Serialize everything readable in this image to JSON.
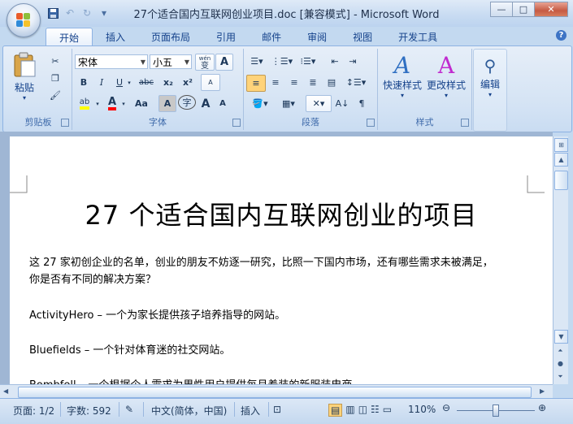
{
  "window": {
    "title": "27个适合国内互联网创业项目.doc [兼容模式] - Microsoft Word",
    "controls": [
      "—",
      "□",
      "✕"
    ]
  },
  "qat": [
    "save-icon",
    "undo-icon",
    "redo-icon",
    "customize-icon"
  ],
  "tabs": [
    {
      "label": "开始",
      "active": true
    },
    {
      "label": "插入"
    },
    {
      "label": "页面布局"
    },
    {
      "label": "引用"
    },
    {
      "label": "邮件"
    },
    {
      "label": "审阅"
    },
    {
      "label": "视图"
    },
    {
      "label": "开发工具"
    }
  ],
  "ribbon": {
    "clipboard": {
      "label": "剪贴板",
      "paste": "粘贴"
    },
    "font": {
      "label": "字体",
      "font_name": "宋体",
      "font_size": "小五",
      "wen": "wén",
      "bian": "变",
      "A": "A",
      "bold": "B",
      "italic": "I",
      "underline": "U",
      "strike": "abc",
      "sub": "x₂",
      "sup": "x²",
      "aa": "Aa",
      "Aa": "Aa",
      "char_border": "A",
      "circle": "字",
      "grow": "A",
      "shrink": "A",
      "clear": "A"
    },
    "paragraph": {
      "label": "段落"
    },
    "styles": {
      "label": "样式",
      "quick": "快速样式",
      "change": "更改样式"
    },
    "editing": {
      "label": "编辑"
    }
  },
  "document": {
    "title": "27 个适合国内互联网创业的项目",
    "intro_line1": "这 27 家初创企业的名单，创业的朋友不妨逐一研究，比照一下国内市场，还有哪些需求未被满足，",
    "intro_line2": "你是否有不同的解决方案？",
    "item1": "ActivityHero – 一个为家长提供孩子培养指导的网站。",
    "item2": "Bluefields – 一个针对体育迷的社交网站。",
    "item3": "Bombfell – 一个根据个人需求为男性用户提供每月着装的新服装电商。"
  },
  "status": {
    "page": "页面: 1/2",
    "words": "字数: 592",
    "language": "中文(简体，中国)",
    "mode": "插入",
    "zoom": "110%"
  },
  "colors": {
    "accent": "#15428b",
    "ribbon": "#d4e3f4",
    "highlight": "#ffff00",
    "font_color": "#ff0000"
  }
}
